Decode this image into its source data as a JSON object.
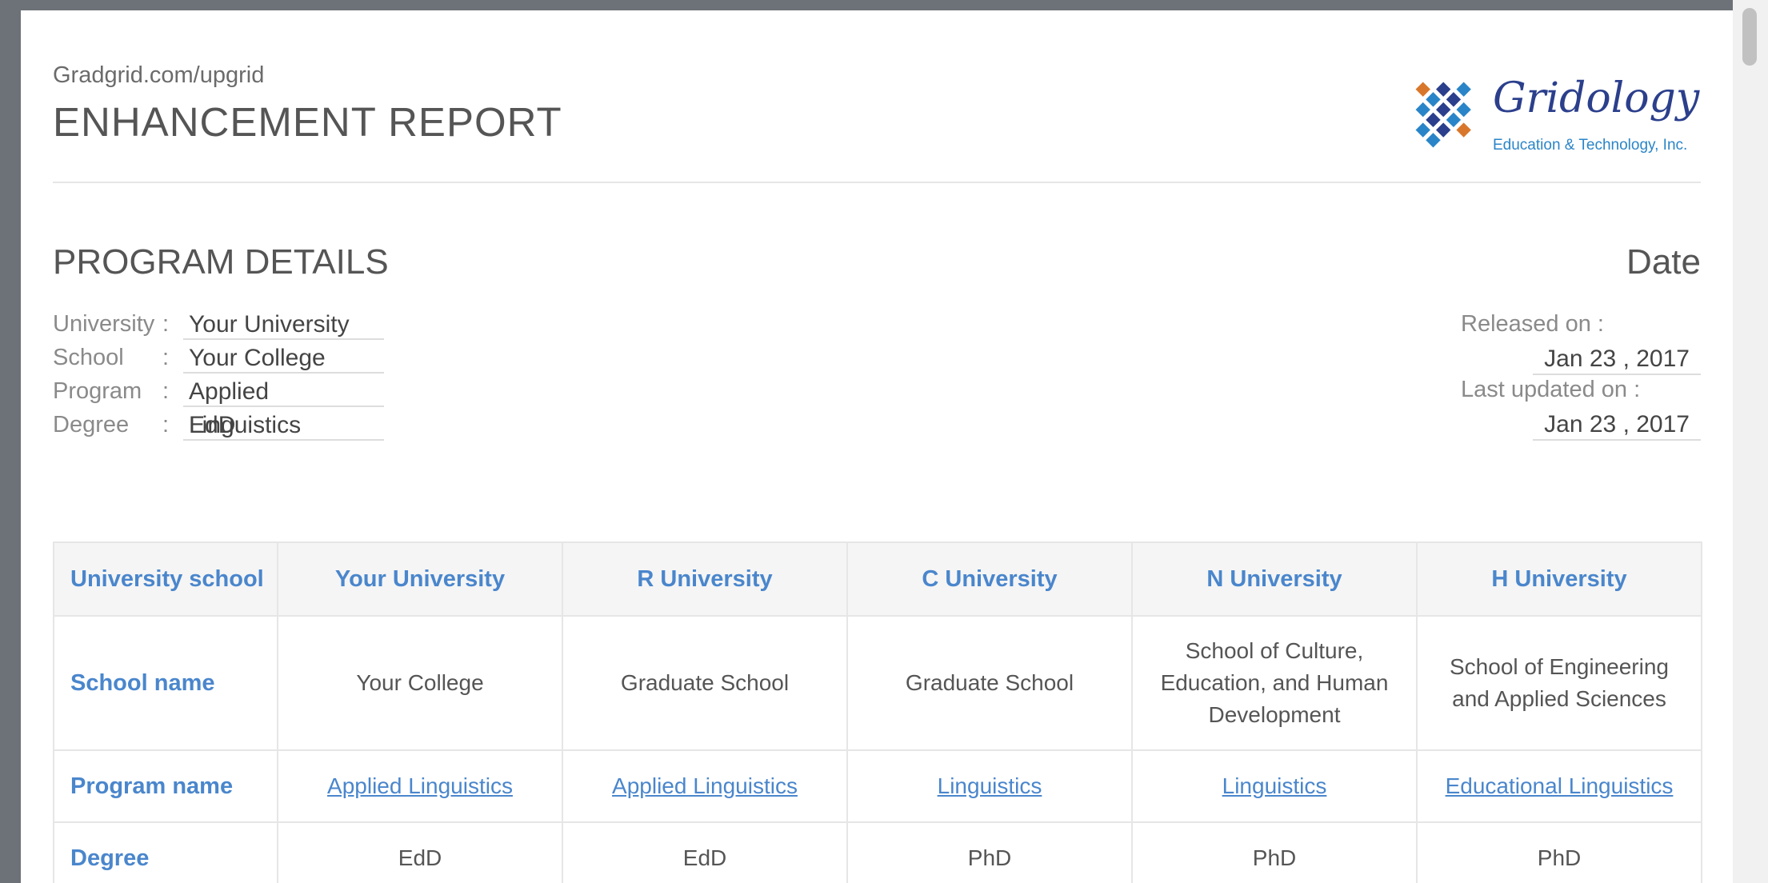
{
  "header": {
    "site_url": "Gradgrid.com/upgrid",
    "report_title": "ENHANCEMENT REPORT",
    "logo": {
      "name": "Gridology",
      "tagline": "Education & Technology, Inc.",
      "colors": {
        "navy": "#2b3f8c",
        "blue": "#2a85c8",
        "orange": "#d8772b"
      }
    }
  },
  "program_details": {
    "title": "PROGRAM DETAILS",
    "fields": [
      {
        "label": "University",
        "value": "Your University"
      },
      {
        "label": "School",
        "value": "Your College"
      },
      {
        "label": "Program",
        "value": "Applied Linguistics"
      },
      {
        "label": "Degree",
        "value": "EdD"
      }
    ]
  },
  "dates": {
    "title": "Date",
    "released_label": "Released on :",
    "released_value": "Jan 23 , 2017",
    "updated_label": "Last updated on :",
    "updated_value": "Jan 23 , 2017"
  },
  "comparison_table": {
    "header": [
      "University school",
      "Your University",
      "R University",
      "C University",
      "N University",
      "H University"
    ],
    "rows": [
      {
        "label": "School name",
        "cells": [
          "Your College",
          "Graduate School",
          "Graduate School",
          "School of Culture, Education, and Human Development",
          "School of Engineering and Applied Sciences"
        ]
      },
      {
        "label": "Program name",
        "cells": [
          "Applied Linguistics",
          "Applied Linguistics",
          "Linguistics",
          "Linguistics",
          "Educational Linguistics"
        ]
      },
      {
        "label": "Degree",
        "cells": [
          "EdD",
          "EdD",
          "PhD",
          "PhD",
          "PhD"
        ]
      }
    ]
  },
  "theme": {
    "accent": "#4a86cc",
    "text": "#555555",
    "border": "#e6e6e6",
    "header_bg": "#f5f5f5"
  }
}
